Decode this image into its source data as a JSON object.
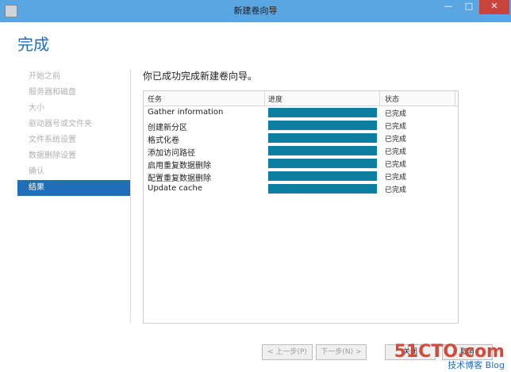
{
  "window": {
    "title": "新建卷向导"
  },
  "header": {
    "title": "完成"
  },
  "nav": {
    "items": [
      {
        "label": "开始之前"
      },
      {
        "label": "服务器和磁盘"
      },
      {
        "label": "大小"
      },
      {
        "label": "驱动器号或文件夹"
      },
      {
        "label": "文件系统设置"
      },
      {
        "label": "数据删除设置"
      },
      {
        "label": "确认"
      },
      {
        "label": "结果"
      }
    ],
    "active_index": 7
  },
  "main": {
    "heading": "你已成功完成新建卷向导。",
    "table": {
      "columns": [
        "任务",
        "进度",
        "状态"
      ],
      "rows": [
        {
          "task": "Gather information",
          "status": "已完成",
          "progress": 1.0
        },
        {
          "task": "创建新分区",
          "status": "已完成",
          "progress": 1.0
        },
        {
          "task": "格式化卷",
          "status": "已完成",
          "progress": 1.0
        },
        {
          "task": "添加访问路径",
          "status": "已完成",
          "progress": 1.0
        },
        {
          "task": "启用重复数据删除",
          "status": "已完成",
          "progress": 1.0
        },
        {
          "task": "配置重复数据删除",
          "status": "已完成",
          "progress": 1.0
        },
        {
          "task": "Update cache",
          "status": "已完成",
          "progress": 1.0
        }
      ]
    }
  },
  "footer": {
    "prev_label": "< 上一步(P)",
    "next_label": "下一步(N) >",
    "finish_label": "关闭",
    "cancel_label": "取消"
  },
  "watermark": {
    "line1": "51CTO.com",
    "line2": "技术博客 Blog"
  },
  "colors": {
    "accent": "#1e6fb8",
    "progress": "#0f7fa1",
    "titlebar": "#5aa6e3"
  }
}
